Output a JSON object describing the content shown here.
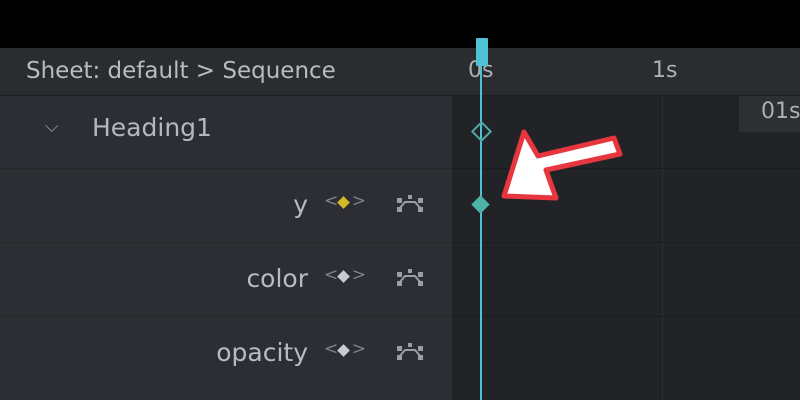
{
  "header": {
    "title": "Sheet: default > Sequence"
  },
  "tree": {
    "object": {
      "chevron": "⌵",
      "label": "Heading1"
    },
    "props": [
      {
        "label": "y",
        "has_keyframe": true
      },
      {
        "label": "color",
        "has_keyframe": false
      },
      {
        "label": "opacity",
        "has_keyframe": false
      }
    ]
  },
  "timeline": {
    "ticks": [
      "0s",
      "1s"
    ],
    "current_time": "01s"
  },
  "colors": {
    "accent": "#4ec2d4",
    "keyframe": "#4db3a8",
    "keyframe_active": "#d4b82a",
    "annotation": "#e8363f"
  },
  "icons": {
    "prev": "<",
    "next": ">",
    "curve": "curve-editor-icon",
    "annotation": "pointer-arrow-icon"
  }
}
